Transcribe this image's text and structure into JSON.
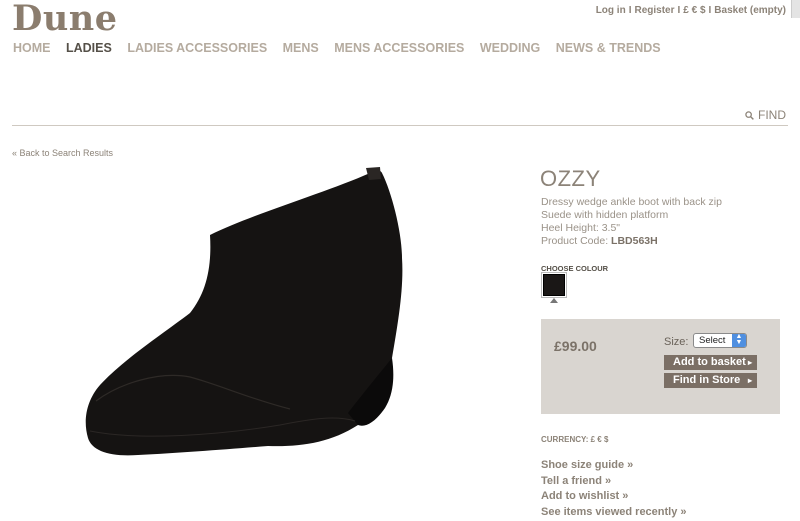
{
  "brand": {
    "logo": "Dune"
  },
  "top_links": {
    "login": "Log in",
    "register": "Register",
    "currency": "£ € $",
    "basket": "Basket (empty)",
    "separator": "I"
  },
  "main_nav": [
    "HOME",
    "LADIES",
    "LADIES ACCESSORIES",
    "MENS",
    "MENS ACCESSORIES",
    "WEDDING",
    "NEWS & TRENDS"
  ],
  "active_nav": "LADIES",
  "search": {
    "label": "FIND"
  },
  "breadcrumb": {
    "back": "« Back to Search Results"
  },
  "product": {
    "name": "OZZY",
    "description": [
      "Dressy wedge ankle boot with back zip",
      "Suede with hidden platform",
      "Heel Height: 3.5\""
    ],
    "code_label": "Product Code:",
    "code": "LBD563H",
    "choose_colour_label": "CHOOSE COLOUR",
    "colour_swatch": "#1a1716",
    "price": "£99.00",
    "size_label": "Size:",
    "size_selected": "Select",
    "add_to_basket": "Add to basket",
    "find_in_store": "Find in Store",
    "currency_label": "CURRENCY: £ € $"
  },
  "extra_links": [
    "Shoe size guide »",
    "Tell a friend »",
    "Add to wishlist »",
    "See items viewed recently »"
  ],
  "colors": {
    "brand": "#8b7d6e",
    "nav": "#b5ab9f",
    "nav_active": "#555048",
    "button": "#7b6f65",
    "panel": "#d9d5d0"
  }
}
